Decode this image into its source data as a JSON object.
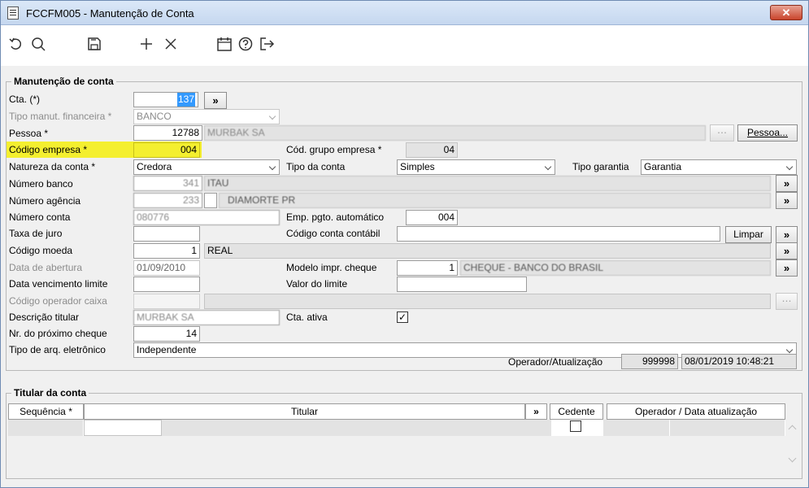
{
  "window": {
    "title": "FCCFM005 - Manutenção de Conta",
    "close": "✕"
  },
  "toolbar": {
    "undo": "↺",
    "search": "⌕",
    "save": "💾",
    "add": "+",
    "delete": "✕",
    "calendar": "📅",
    "help": "?",
    "exit": "↦"
  },
  "section1": {
    "title": "Manutenção de conta",
    "cta_label": "Cta. (*)",
    "cta_value": "137",
    "tipo_label": "Tipo manut. financeira *",
    "tipo_value": "BANCO",
    "pessoa_label": "Pessoa *",
    "pessoa_code": "12788",
    "pessoa_name": "MURBAK SA",
    "pessoa_btn": "Pessoa...",
    "empresa_label": "Código empresa *",
    "empresa_value": "004",
    "grupo_label": "Cód. grupo empresa *",
    "grupo_value": "04",
    "natureza_label": "Natureza da conta *",
    "natureza_value": "Credora",
    "tipo_conta_label": "Tipo da conta",
    "tipo_conta_value": "Simples",
    "tipo_garantia_label": "Tipo garantia",
    "tipo_garantia_value": "Garantia",
    "banco_label": "Número banco",
    "banco_code": "341",
    "banco_name": "ITAU",
    "agencia_label": "Número agência",
    "agencia_code": "233",
    "agencia_name": "DIAMORTE PR",
    "conta_label": "Número conta",
    "conta_value": "080776",
    "emp_pgto_label": "Emp. pgto. automático",
    "emp_pgto_value": "004",
    "juro_label": "Taxa de juro",
    "contabil_label": "Código conta contábil",
    "limpar_btn": "Limpar",
    "moeda_label": "Código moeda",
    "moeda_code": "1",
    "moeda_name": "REAL",
    "abertura_label": "Data de abertura",
    "abertura_value": "01/09/2010",
    "modelo_label": "Modelo impr. cheque",
    "modelo_code": "1",
    "modelo_name": "CHEQUE - BANCO DO BRASIL",
    "venc_label": "Data vencimento limite",
    "valor_limite_label": "Valor do limite",
    "operador_caixa_label": "Código operador caixa",
    "descricao_label": "Descrição titular",
    "descricao_value": "MURBAK SA",
    "ativa_label": "Cta. ativa",
    "ativa_check": "✓",
    "prox_cheque_label": "Nr. do próximo cheque",
    "prox_cheque_value": "14",
    "arq_label": "Tipo de arq. eletrônico",
    "arq_value": "Independente",
    "op_atual_label": "Operador/Atualização",
    "op_code": "999998",
    "op_date": "08/01/2019 10:48:21",
    "more": "»",
    "dots": "⋯"
  },
  "section2": {
    "title": "Titular da conta",
    "col_seq": "Sequência *",
    "col_titular": "Titular",
    "col_more": "»",
    "col_cedente": "Cedente",
    "col_operador": "Operador / Data atualização"
  }
}
